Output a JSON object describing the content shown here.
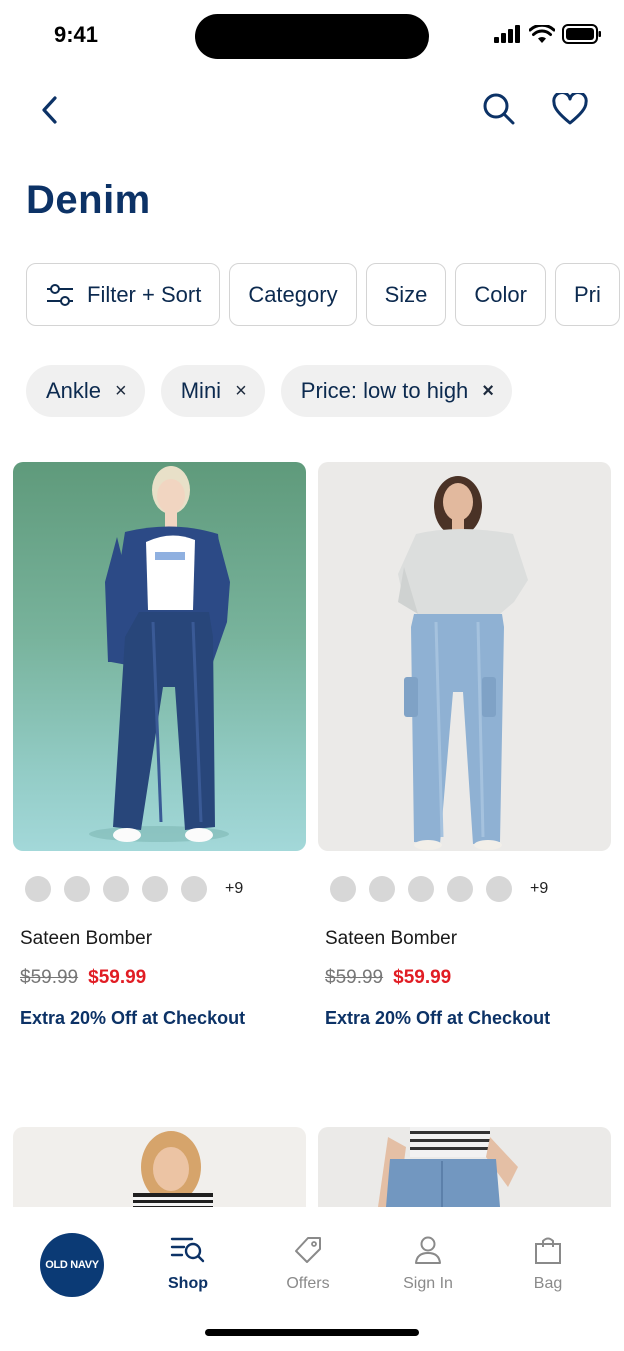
{
  "status_bar": {
    "time": "9:41"
  },
  "page": {
    "title": "Denim"
  },
  "filters": [
    "Filter + Sort",
    "Category",
    "Size",
    "Color",
    "Pri"
  ],
  "applied_filters": [
    {
      "label": "Ankle",
      "remove": "×"
    },
    {
      "label": "Mini",
      "remove": "×"
    },
    {
      "label": "Price: low to high",
      "remove": "×"
    }
  ],
  "products": [
    {
      "name": "Sateen Bomber",
      "old_price": "$59.99",
      "sale_price": "$59.99",
      "promo": "Extra 20% Off at Checkout",
      "more_colors": "+9"
    },
    {
      "name": "Sateen Bomber",
      "old_price": "$59.99",
      "sale_price": "$59.99",
      "promo": "Extra 20% Off at Checkout",
      "more_colors": "+9"
    }
  ],
  "tab_bar": {
    "logo": "OLD NAVY",
    "tabs": [
      {
        "label": "Shop",
        "icon": "shop-search-icon"
      },
      {
        "label": "Offers",
        "icon": "tag-icon"
      },
      {
        "label": "Sign In",
        "icon": "person-icon"
      },
      {
        "label": "Bag",
        "icon": "bag-icon"
      }
    ]
  },
  "colors": {
    "brand_navy": "#0c3266",
    "sale_red": "#e11d24",
    "logo_blue": "#0b3a75"
  }
}
